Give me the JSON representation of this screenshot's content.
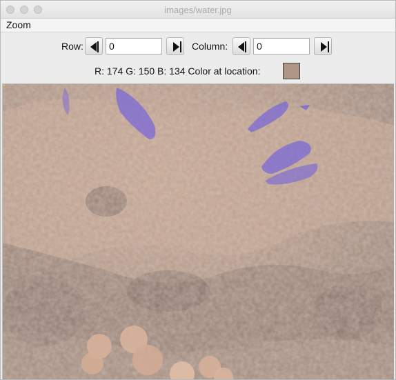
{
  "window": {
    "title": "images/water.jpg"
  },
  "menu": {
    "items": [
      "Zoom"
    ]
  },
  "controls": {
    "row_label": "Row:",
    "row_value": "0",
    "column_label": "Column:",
    "column_value": "0",
    "color_readout": "R: 174 G: 150 B: 134 Color at location:",
    "swatch_color": "#ae9686"
  },
  "image": {
    "fish_color": "#7a68d6",
    "icons": [
      "prev-row-icon",
      "next-row-icon",
      "prev-column-icon",
      "next-column-icon"
    ]
  }
}
